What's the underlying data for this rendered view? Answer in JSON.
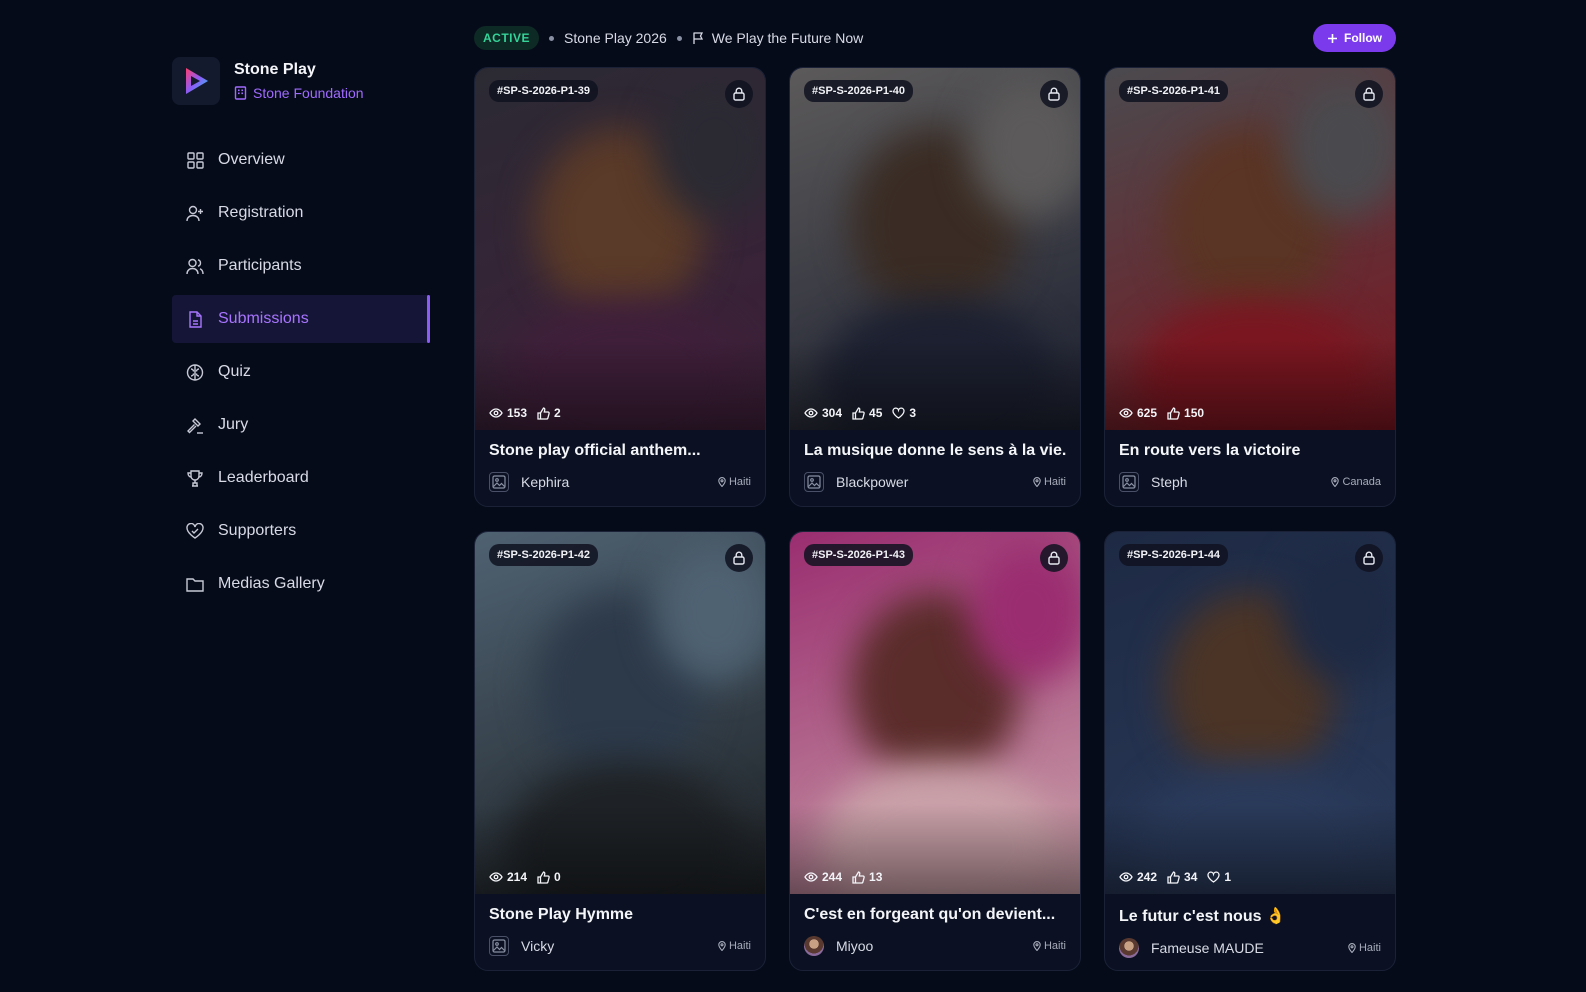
{
  "brand": {
    "name": "Stone Play",
    "org": "Stone Foundation"
  },
  "nav": [
    {
      "label": "Overview",
      "icon": "grid-icon",
      "active": false
    },
    {
      "label": "Registration",
      "icon": "user-plus-icon",
      "active": false
    },
    {
      "label": "Participants",
      "icon": "users-icon",
      "active": false
    },
    {
      "label": "Submissions",
      "icon": "file-icon",
      "active": true
    },
    {
      "label": "Quiz",
      "icon": "brain-icon",
      "active": false
    },
    {
      "label": "Jury",
      "icon": "gavel-icon",
      "active": false
    },
    {
      "label": "Leaderboard",
      "icon": "trophy-icon",
      "active": false
    },
    {
      "label": "Supporters",
      "icon": "heart-handshake-icon",
      "active": false
    },
    {
      "label": "Medias Gallery",
      "icon": "folder-icon",
      "active": false
    }
  ],
  "header": {
    "status": "ACTIVE",
    "event": "Stone Play 2026",
    "motto": "We Play the Future Now",
    "follow_label": "Follow"
  },
  "colors": {
    "accent": "#7c3aed",
    "accent_text": "#a874ff",
    "status_green": "#34d399",
    "background": "#060b1a"
  },
  "submissions": [
    {
      "code": "#SP-S-2026-P1-39",
      "views": "153",
      "likes": "2",
      "hearts": "",
      "title": "Stone play official anthem...",
      "author": "Kephira",
      "location": "Haiti",
      "avatar": "image-placeholder",
      "bg": [
        "#2b2a33",
        "#5a3a28",
        "#3f1f3a"
      ]
    },
    {
      "code": "#SP-S-2026-P1-40",
      "views": "304",
      "likes": "45",
      "hearts": "3",
      "title": "La musique donne le sens à la vie.",
      "author": "Blackpower",
      "location": "Haiti",
      "avatar": "image-placeholder",
      "bg": [
        "#5c5a5a",
        "#3a2c24",
        "#1c2030"
      ]
    },
    {
      "code": "#SP-S-2026-P1-41",
      "views": "625",
      "likes": "150",
      "hearts": "",
      "title": "En route vers la victoire",
      "author": "Steph",
      "location": "Canada",
      "avatar": "image-placeholder",
      "bg": [
        "#4a4a4e",
        "#5a3424",
        "#7a1620"
      ]
    },
    {
      "code": "#SP-S-2026-P1-42",
      "views": "214",
      "likes": "0",
      "hearts": "",
      "title": "Stone Play Hymme",
      "author": "Vicky",
      "location": "Haiti",
      "avatar": "image-placeholder",
      "bg": [
        "#4f6272",
        "#2d3a4a",
        "#1e2226"
      ]
    },
    {
      "code": "#SP-S-2026-P1-43",
      "views": "244",
      "likes": "13",
      "hearts": "",
      "title": "C'est en forgeant qu'on devient...",
      "author": "Miyoo",
      "location": "Haiti",
      "avatar": "photo",
      "bg": [
        "#9a2d70",
        "#5a2c2a",
        "#c9a0a8"
      ]
    },
    {
      "code": "#SP-S-2026-P1-44",
      "views": "242",
      "likes": "34",
      "hearts": "1",
      "title": "Le futur c'est nous 👌",
      "author": "Fameuse MAUDE",
      "location": "Haiti",
      "avatar": "photo",
      "bg": [
        "#1e2a44",
        "#4b3426",
        "#2a3a5a"
      ]
    }
  ]
}
